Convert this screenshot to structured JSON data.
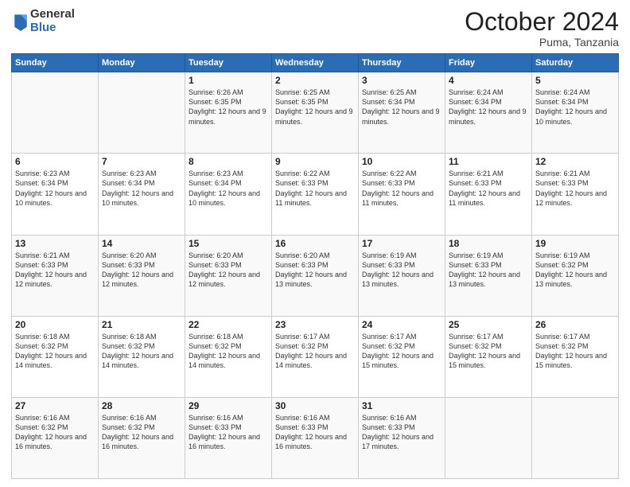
{
  "header": {
    "logo_general": "General",
    "logo_blue": "Blue",
    "month_title": "October 2024",
    "location": "Puma, Tanzania"
  },
  "weekdays": [
    "Sunday",
    "Monday",
    "Tuesday",
    "Wednesday",
    "Thursday",
    "Friday",
    "Saturday"
  ],
  "weeks": [
    [
      {
        "day": "",
        "info": ""
      },
      {
        "day": "",
        "info": ""
      },
      {
        "day": "1",
        "info": "Sunrise: 6:26 AM\nSunset: 6:35 PM\nDaylight: 12 hours and 9 minutes."
      },
      {
        "day": "2",
        "info": "Sunrise: 6:25 AM\nSunset: 6:35 PM\nDaylight: 12 hours and 9 minutes."
      },
      {
        "day": "3",
        "info": "Sunrise: 6:25 AM\nSunset: 6:34 PM\nDaylight: 12 hours and 9 minutes."
      },
      {
        "day": "4",
        "info": "Sunrise: 6:24 AM\nSunset: 6:34 PM\nDaylight: 12 hours and 9 minutes."
      },
      {
        "day": "5",
        "info": "Sunrise: 6:24 AM\nSunset: 6:34 PM\nDaylight: 12 hours and 10 minutes."
      }
    ],
    [
      {
        "day": "6",
        "info": "Sunrise: 6:23 AM\nSunset: 6:34 PM\nDaylight: 12 hours and 10 minutes."
      },
      {
        "day": "7",
        "info": "Sunrise: 6:23 AM\nSunset: 6:34 PM\nDaylight: 12 hours and 10 minutes."
      },
      {
        "day": "8",
        "info": "Sunrise: 6:23 AM\nSunset: 6:34 PM\nDaylight: 12 hours and 10 minutes."
      },
      {
        "day": "9",
        "info": "Sunrise: 6:22 AM\nSunset: 6:33 PM\nDaylight: 12 hours and 11 minutes."
      },
      {
        "day": "10",
        "info": "Sunrise: 6:22 AM\nSunset: 6:33 PM\nDaylight: 12 hours and 11 minutes."
      },
      {
        "day": "11",
        "info": "Sunrise: 6:21 AM\nSunset: 6:33 PM\nDaylight: 12 hours and 11 minutes."
      },
      {
        "day": "12",
        "info": "Sunrise: 6:21 AM\nSunset: 6:33 PM\nDaylight: 12 hours and 12 minutes."
      }
    ],
    [
      {
        "day": "13",
        "info": "Sunrise: 6:21 AM\nSunset: 6:33 PM\nDaylight: 12 hours and 12 minutes."
      },
      {
        "day": "14",
        "info": "Sunrise: 6:20 AM\nSunset: 6:33 PM\nDaylight: 12 hours and 12 minutes."
      },
      {
        "day": "15",
        "info": "Sunrise: 6:20 AM\nSunset: 6:33 PM\nDaylight: 12 hours and 12 minutes."
      },
      {
        "day": "16",
        "info": "Sunrise: 6:20 AM\nSunset: 6:33 PM\nDaylight: 12 hours and 13 minutes."
      },
      {
        "day": "17",
        "info": "Sunrise: 6:19 AM\nSunset: 6:33 PM\nDaylight: 12 hours and 13 minutes."
      },
      {
        "day": "18",
        "info": "Sunrise: 6:19 AM\nSunset: 6:33 PM\nDaylight: 12 hours and 13 minutes."
      },
      {
        "day": "19",
        "info": "Sunrise: 6:19 AM\nSunset: 6:32 PM\nDaylight: 12 hours and 13 minutes."
      }
    ],
    [
      {
        "day": "20",
        "info": "Sunrise: 6:18 AM\nSunset: 6:32 PM\nDaylight: 12 hours and 14 minutes."
      },
      {
        "day": "21",
        "info": "Sunrise: 6:18 AM\nSunset: 6:32 PM\nDaylight: 12 hours and 14 minutes."
      },
      {
        "day": "22",
        "info": "Sunrise: 6:18 AM\nSunset: 6:32 PM\nDaylight: 12 hours and 14 minutes."
      },
      {
        "day": "23",
        "info": "Sunrise: 6:17 AM\nSunset: 6:32 PM\nDaylight: 12 hours and 14 minutes."
      },
      {
        "day": "24",
        "info": "Sunrise: 6:17 AM\nSunset: 6:32 PM\nDaylight: 12 hours and 15 minutes."
      },
      {
        "day": "25",
        "info": "Sunrise: 6:17 AM\nSunset: 6:32 PM\nDaylight: 12 hours and 15 minutes."
      },
      {
        "day": "26",
        "info": "Sunrise: 6:17 AM\nSunset: 6:32 PM\nDaylight: 12 hours and 15 minutes."
      }
    ],
    [
      {
        "day": "27",
        "info": "Sunrise: 6:16 AM\nSunset: 6:32 PM\nDaylight: 12 hours and 16 minutes."
      },
      {
        "day": "28",
        "info": "Sunrise: 6:16 AM\nSunset: 6:32 PM\nDaylight: 12 hours and 16 minutes."
      },
      {
        "day": "29",
        "info": "Sunrise: 6:16 AM\nSunset: 6:33 PM\nDaylight: 12 hours and 16 minutes."
      },
      {
        "day": "30",
        "info": "Sunrise: 6:16 AM\nSunset: 6:33 PM\nDaylight: 12 hours and 16 minutes."
      },
      {
        "day": "31",
        "info": "Sunrise: 6:16 AM\nSunset: 6:33 PM\nDaylight: 12 hours and 17 minutes."
      },
      {
        "day": "",
        "info": ""
      },
      {
        "day": "",
        "info": ""
      }
    ]
  ]
}
